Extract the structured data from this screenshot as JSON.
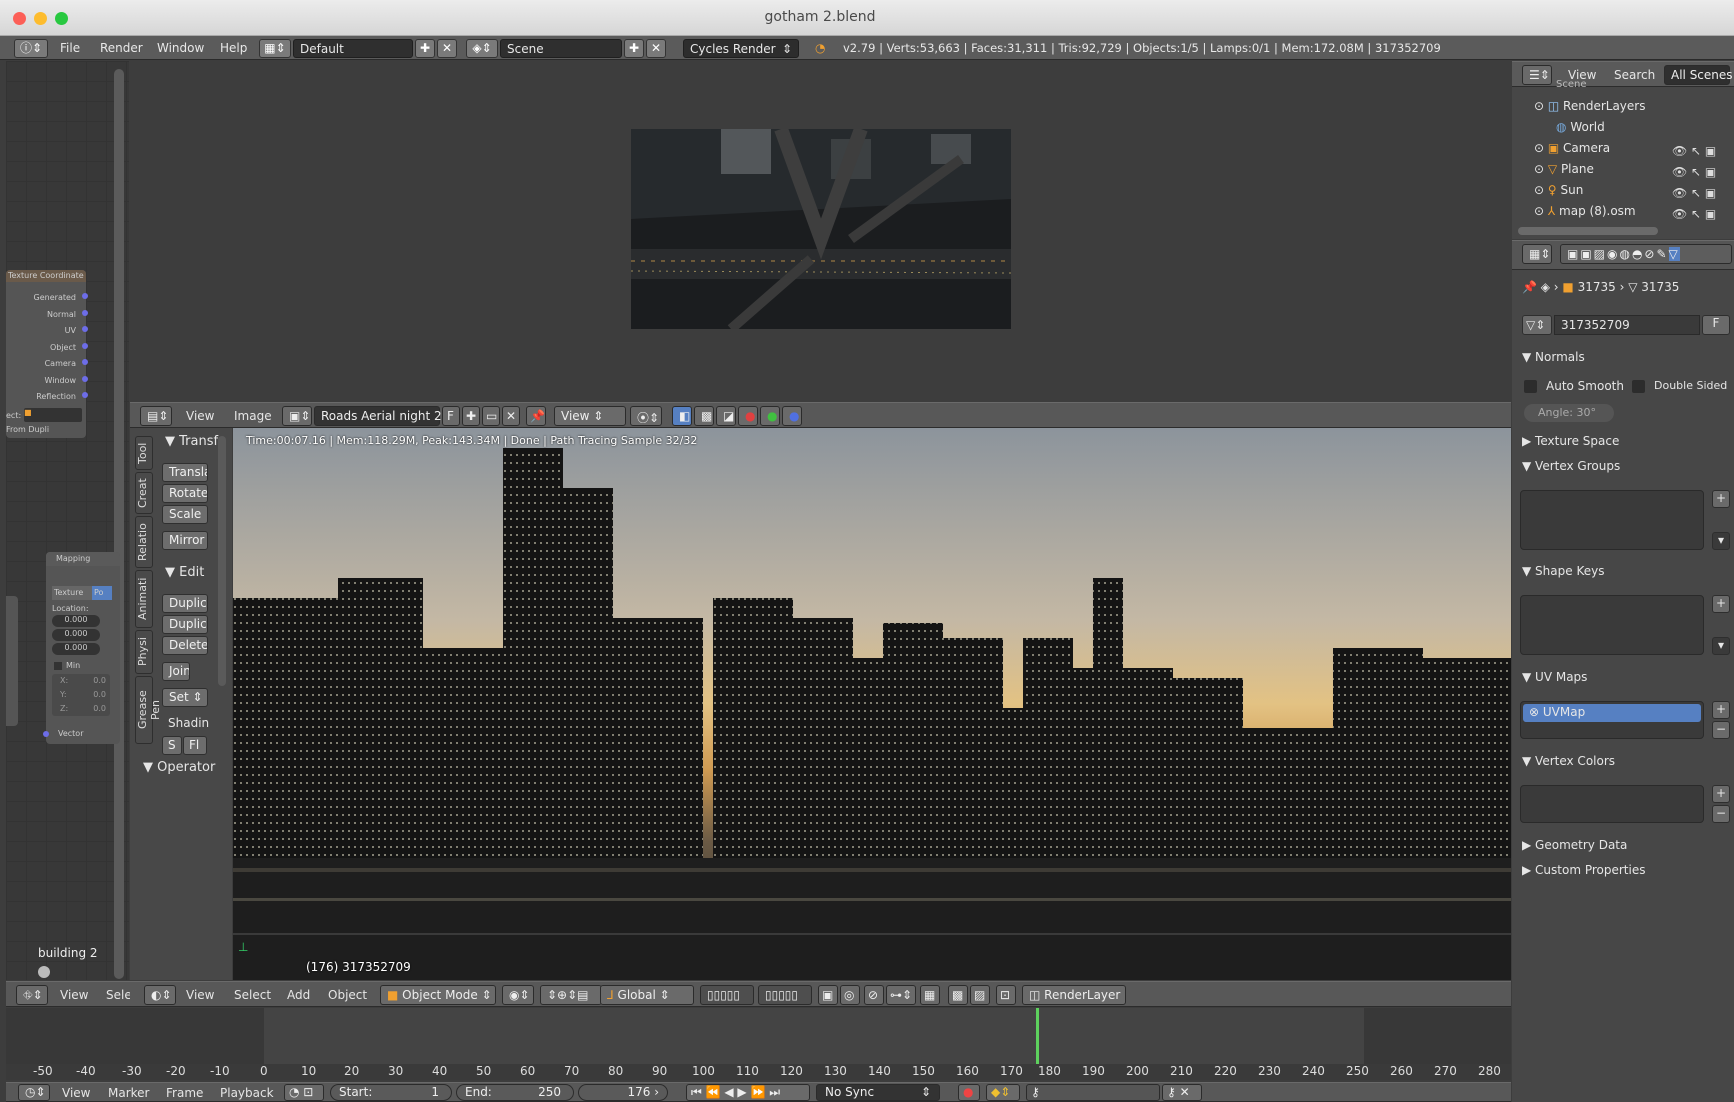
{
  "window": {
    "title": "gotham 2.blend"
  },
  "infobar": {
    "menu": [
      "File",
      "Render",
      "Window",
      "Help"
    ],
    "layout": "Default",
    "scene": "Scene",
    "engine": "Cycles Render",
    "stats": "v2.79 | Verts:53,663 | Faces:31,311 | Tris:92,729 | Objects:1/5 | Lamps:0/1 | Mem:172.08M | 317352709"
  },
  "node_editor": {
    "node1": {
      "title": "Texture Coordinate",
      "outputs": [
        "Generated",
        "Normal",
        "UV",
        "Object",
        "Camera",
        "Window",
        "Reflection"
      ],
      "field": "From Dupli"
    },
    "node2": {
      "title": "Mapping",
      "tabs": [
        "Texture",
        "Po"
      ],
      "location_label": "Location:",
      "values": [
        "0.000",
        "0.000",
        "0.000"
      ],
      "min_label": "Min",
      "xyz": [
        "X:",
        "Y:",
        "Z:"
      ],
      "xyz_vals": [
        "0.0",
        "0.0",
        "0.0"
      ],
      "socket": "Vector"
    },
    "footer": "building 2",
    "left_label": "ect:"
  },
  "image_editor": {
    "menu": [
      "View",
      "Image"
    ],
    "image_name": "Roads Aerial night 2...",
    "flag": "F",
    "view_label": "View",
    "status": "Time:00:07.16 | Mem:118.29M, Peak:143.34M | Done | Path Tracing Sample 32/32",
    "object_label": "(176) 317352709"
  },
  "toolshelf": {
    "tabs": [
      "Tool",
      "Creat",
      "Relatio",
      "Animati",
      "Physi",
      "Grease Pen"
    ],
    "transform": "Transf",
    "buttons1": [
      "Transla",
      "Rotate",
      "Scale",
      "Mirror"
    ],
    "edit": "Edit",
    "buttons2": [
      "Duplic",
      "Duplic",
      "Delete",
      "Join"
    ],
    "set": "Set",
    "shading": "Shadin",
    "shade_btns": [
      "S",
      "Fl"
    ],
    "operator": "Operator"
  },
  "view3d_header": {
    "items": [
      "View",
      "Select",
      "Add",
      "Object"
    ],
    "mode": "Object Mode",
    "orientation": "Global",
    "layer": "RenderLayer",
    "left_items": [
      "View",
      "Sele"
    ]
  },
  "outliner": {
    "menu": [
      "View",
      "Search"
    ],
    "filter": "All Scenes",
    "items": [
      "Scene",
      "RenderLayers",
      "World",
      "Camera",
      "Plane",
      "Sun",
      "map (8).osm"
    ]
  },
  "properties": {
    "crumbs": [
      "31735",
      "31735"
    ],
    "mesh_name": "317352709",
    "fake": "F",
    "sections": {
      "normals": "Normals",
      "auto_smooth": "Auto Smooth",
      "double_sided": "Double Sided",
      "angle": "Angle:",
      "angle_val": "30°",
      "texture_space": "Texture Space",
      "vertex_groups": "Vertex Groups",
      "shape_keys": "Shape Keys",
      "uv_maps": "UV Maps",
      "uvmap": "UVMap",
      "vertex_colors": "Vertex Colors",
      "geometry_data": "Geometry Data",
      "custom_properties": "Custom Properties"
    }
  },
  "timeline": {
    "ticks": [
      "-50",
      "-40",
      "-30",
      "-20",
      "-10",
      "0",
      "10",
      "20",
      "30",
      "40",
      "50",
      "60",
      "70",
      "80",
      "90",
      "100",
      "110",
      "120",
      "130",
      "140",
      "150",
      "160",
      "170",
      "180",
      "190",
      "200",
      "210",
      "220",
      "230",
      "240",
      "250",
      "260",
      "270",
      "280"
    ],
    "menu": [
      "View",
      "Marker",
      "Frame",
      "Playback"
    ],
    "start_label": "Start:",
    "start": "1",
    "end_label": "End:",
    "end": "250",
    "current": "176",
    "sync": "No Sync"
  }
}
